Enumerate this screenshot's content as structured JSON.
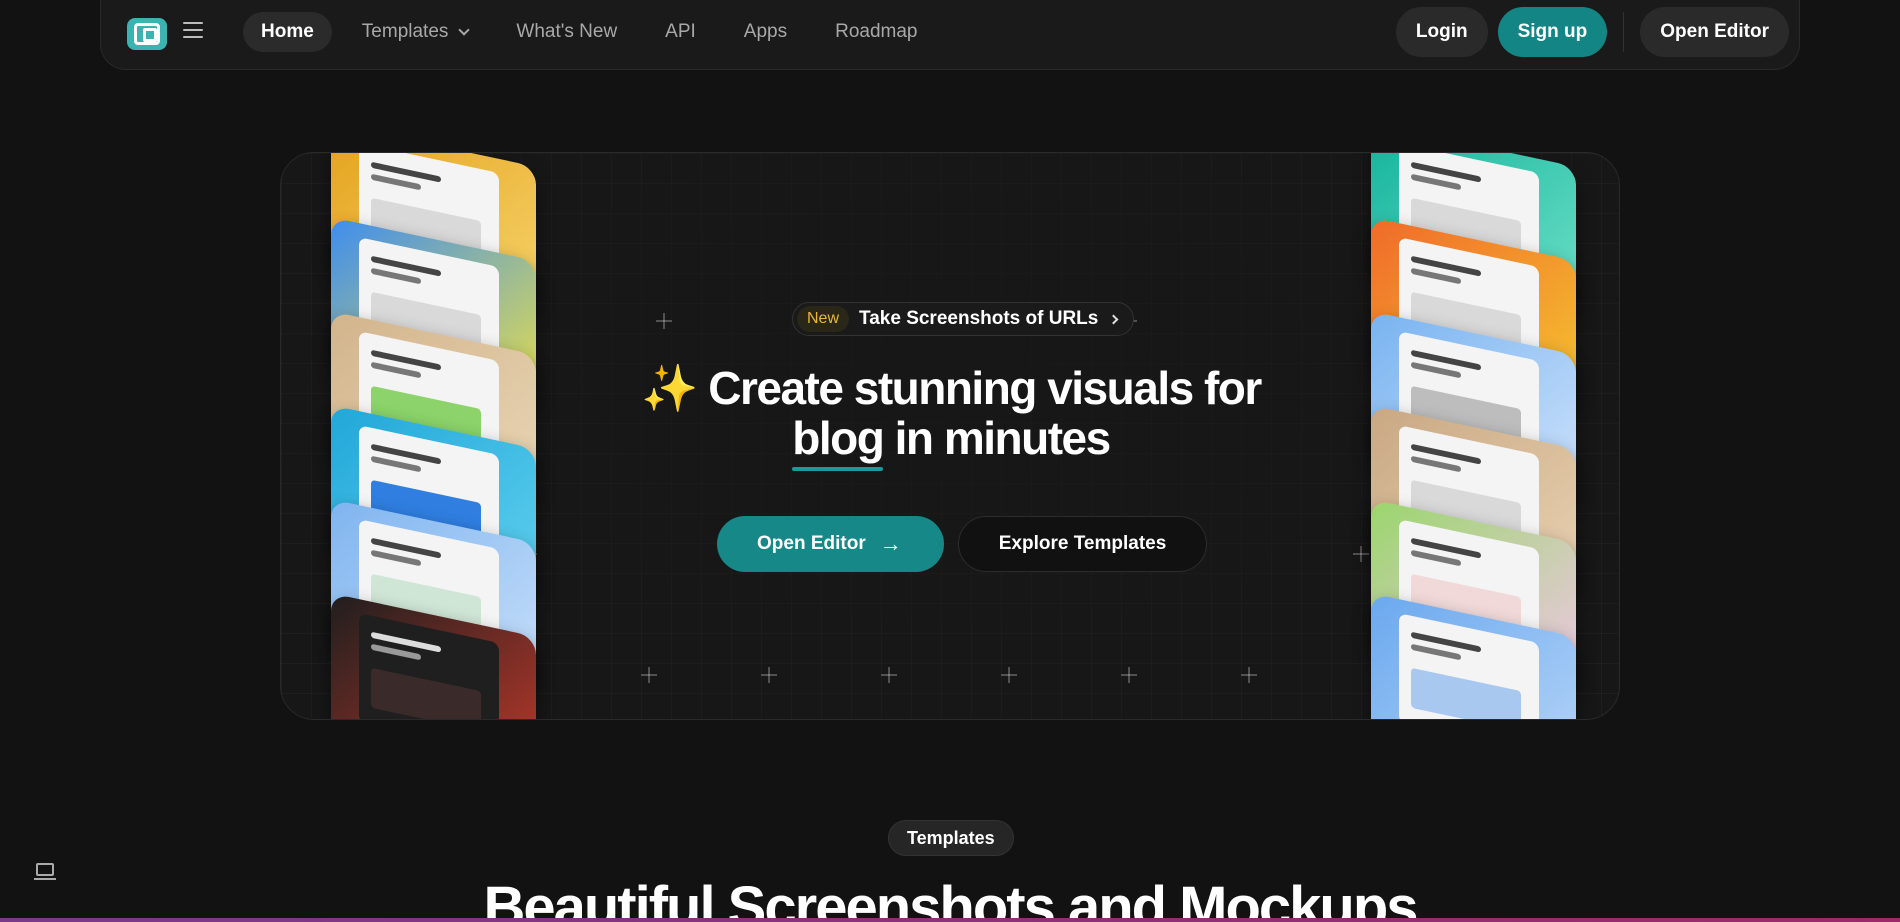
{
  "nav": {
    "links": [
      "Home",
      "Templates",
      "What's New",
      "API",
      "Apps",
      "Roadmap"
    ],
    "login": "Login",
    "signup": "Sign up",
    "open_editor": "Open Editor"
  },
  "hero": {
    "badge_new": "New",
    "badge_text": "Take Screenshots of URLs",
    "headline_emoji": "✨",
    "headline_line1": "Create stunning visuals for",
    "headline_word": "blog",
    "headline_line2_rest": " in minutes",
    "cta_primary": "Open Editor",
    "cta_secondary": "Explore Templates"
  },
  "section": {
    "pill": "Templates",
    "title": "Beautiful Screenshots and Mockups"
  },
  "colors": {
    "accent": "#148585",
    "background": "#121212"
  }
}
